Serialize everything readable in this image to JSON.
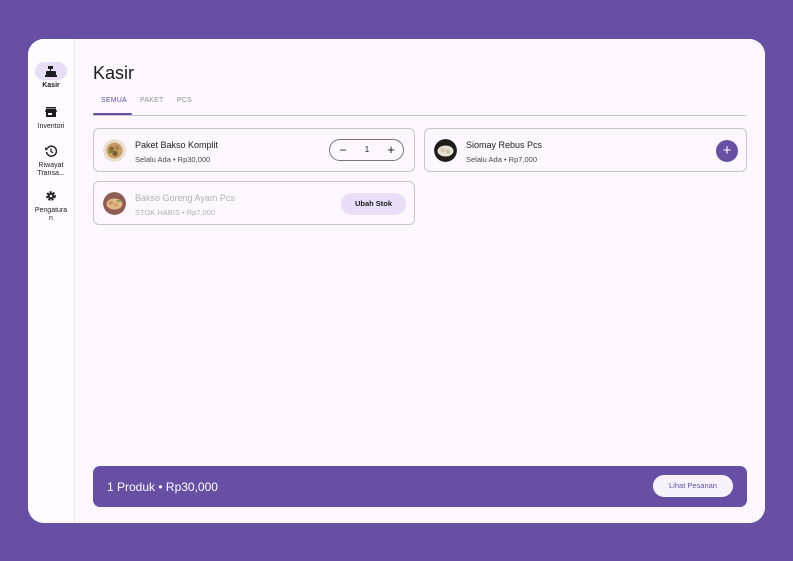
{
  "app": {
    "title": "Kasir"
  },
  "colors": {
    "primary": "#6750a4",
    "secondary_container": "#e8def8",
    "surface": "#fef7ff"
  },
  "status_bar": {
    "icons": [
      "wifi-icon",
      "signal-icon",
      "battery-icon"
    ]
  },
  "nav": {
    "items": [
      {
        "label": "Kasir",
        "icon": "register-icon",
        "active": true
      },
      {
        "label": "Inventori",
        "icon": "store-icon",
        "active": false
      },
      {
        "label": "Riwayat Transa...",
        "icon": "history-icon",
        "active": false
      },
      {
        "label": "Pengaturan",
        "icon": "gear-icon",
        "active": false
      }
    ]
  },
  "tabs": [
    {
      "label": "SEMUA",
      "active": true
    },
    {
      "label": "PAKET",
      "active": false
    },
    {
      "label": "PCS",
      "active": false
    }
  ],
  "products": [
    {
      "name": "Paket Bakso Komplit",
      "sub": "Selalu Ada • Rp30,000",
      "quantity": "1",
      "minus": "−",
      "plus": "+"
    },
    {
      "name": "Siomay Rebus Pcs",
      "sub": "Selalu Ada • Rp7,000",
      "add": "+"
    },
    {
      "name": "Bakso Goreng Ayam Pcs",
      "sub": "STOK HABIS • Rp7,000",
      "action": "Ubah Stok"
    }
  ],
  "order_bar": {
    "summary": "1 Produk • Rp30,000",
    "button": "Lihat Pesanan"
  }
}
